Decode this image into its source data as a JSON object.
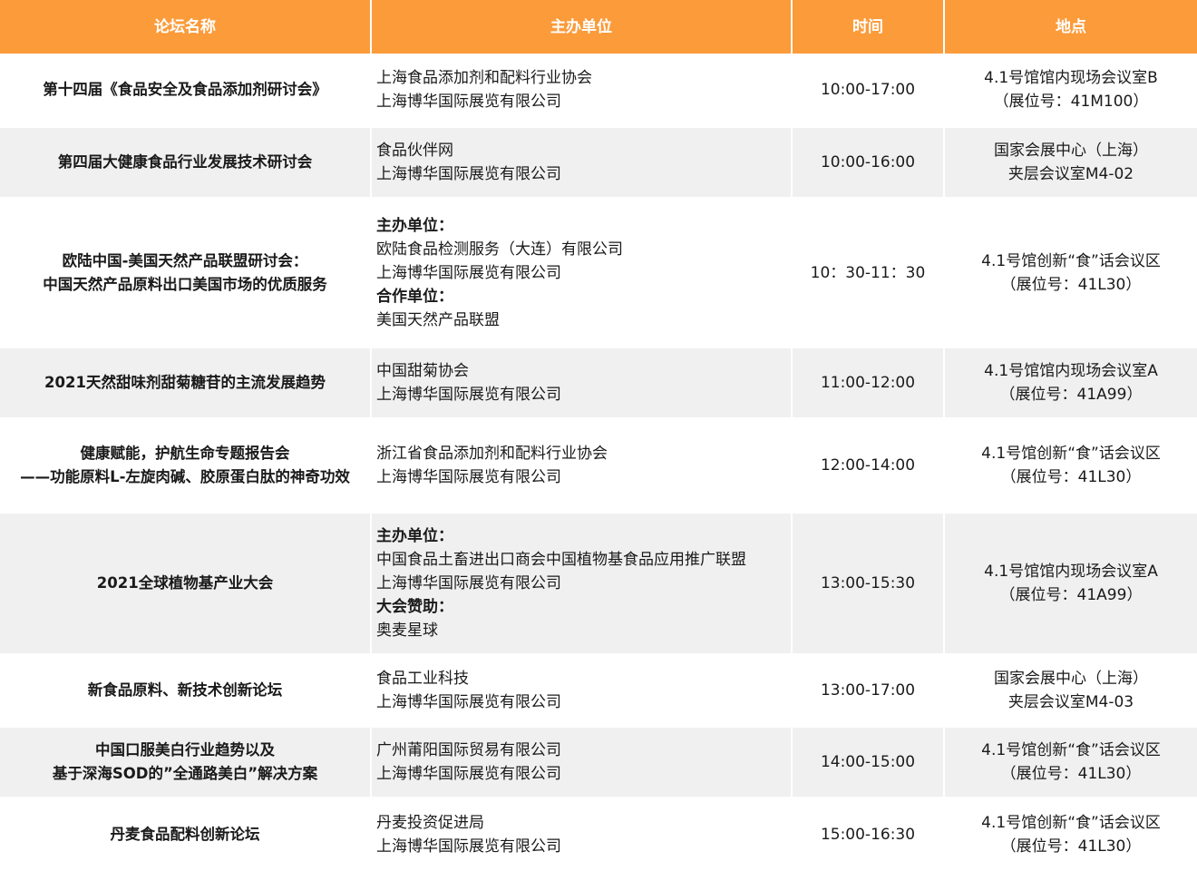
{
  "headers": [
    "论坛名称",
    "主办单位",
    "时间",
    "地点"
  ],
  "rows": [
    {
      "name": [
        "第十四届《食品安全及食品添加剂研讨会》"
      ],
      "org": [
        {
          "t": "上海食品添加剂和配料行业协会"
        },
        {
          "t": "上海博华国际展览有限公司"
        }
      ],
      "time": "10:00-17:00",
      "place": [
        "4.1号馆馆内现场会议室B",
        "（展位号：41M100）"
      ]
    },
    {
      "name": [
        "第四届大健康食品行业发展技术研讨会"
      ],
      "org": [
        {
          "t": "食品伙伴网"
        },
        {
          "t": "上海博华国际展览有限公司"
        }
      ],
      "time": "10:00-16:00",
      "place": [
        "国家会展中心（上海）",
        "夹层会议室M4-02"
      ]
    },
    {
      "name": [
        "欧陆中国-美国天然产品联盟研讨会：",
        "中国天然产品原料出口美国市场的优质服务"
      ],
      "org": [
        {
          "t": "主办单位：",
          "b": true
        },
        {
          "t": "欧陆食品检测服务（大连）有限公司"
        },
        {
          "t": "上海博华国际展览有限公司"
        },
        {
          "t": "合作单位：",
          "b": true
        },
        {
          "t": "美国天然产品联盟"
        }
      ],
      "time": "10：30-11：30",
      "place": [
        "4.1号馆创新“食”话会议区",
        "（展位号：41L30）"
      ]
    },
    {
      "name": [
        "2021天然甜味剂甜菊糖苷的主流发展趋势"
      ],
      "org": [
        {
          "t": "中国甜菊协会"
        },
        {
          "t": "上海博华国际展览有限公司"
        }
      ],
      "time": "11:00-12:00",
      "place": [
        "4.1号馆馆内现场会议室A",
        "（展位号：41A99）"
      ]
    },
    {
      "name": [
        "健康赋能，护航生命专题报告会",
        "——功能原料L-左旋肉碱、胶原蛋白肽的神奇功效"
      ],
      "org": [
        {
          "t": "浙江省食品添加剂和配料行业协会"
        },
        {
          "t": "上海博华国际展览有限公司"
        }
      ],
      "time": "12:00-14:00",
      "place": [
        "4.1号馆创新“食”话会议区",
        "（展位号：41L30）"
      ]
    },
    {
      "name": [
        "2021全球植物基产业大会"
      ],
      "org": [
        {
          "t": "主办单位：",
          "b": true
        },
        {
          "t": "中国食品土畜进出口商会中国植物基食品应用推广联盟"
        },
        {
          "t": "上海博华国际展览有限公司"
        },
        {
          "t": "大会赞助：",
          "b": true
        },
        {
          "t": "奥麦星球"
        }
      ],
      "time": "13:00-15:30",
      "place": [
        "4.1号馆馆内现场会议室A",
        "（展位号：41A99）"
      ]
    },
    {
      "name": [
        "新食品原料、新技术创新论坛"
      ],
      "org": [
        {
          "t": "食品工业科技"
        },
        {
          "t": "上海博华国际展览有限公司"
        }
      ],
      "time": "13:00-17:00",
      "place": [
        "国家会展中心（上海）",
        "夹层会议室M4-03"
      ]
    },
    {
      "name": [
        "中国口服美白行业趋势以及",
        "基于深海SOD的”全通路美白”解决方案"
      ],
      "org": [
        {
          "t": "广州莆阳国际贸易有限公司"
        },
        {
          "t": "上海博华国际展览有限公司"
        }
      ],
      "time": "14:00-15:00",
      "place": [
        "4.1号馆创新“食”话会议区",
        "（展位号：41L30）"
      ]
    },
    {
      "name": [
        "丹麦食品配料创新论坛"
      ],
      "org": [
        {
          "t": "丹麦投资促进局"
        },
        {
          "t": "上海博华国际展览有限公司"
        }
      ],
      "time": "15:00-16:30",
      "place": [
        "4.1号馆创新“食”话会议区",
        "（展位号：41L30）"
      ]
    }
  ]
}
